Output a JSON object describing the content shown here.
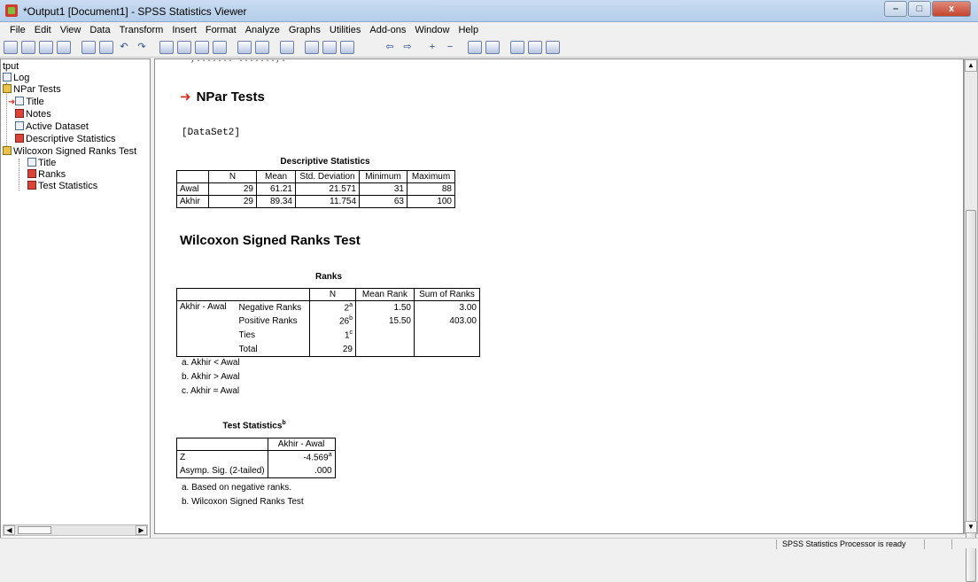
{
  "window": {
    "title": "*Output1 [Document1] - SPSS Statistics Viewer",
    "minimize": "–",
    "maximize": "□",
    "close": "x"
  },
  "menu": [
    "File",
    "Edit",
    "View",
    "Data",
    "Transform",
    "Insert",
    "Format",
    "Analyze",
    "Graphs",
    "Utilities",
    "Add-ons",
    "Window",
    "Help"
  ],
  "toolbar_glyphs": {
    "undo": "↶",
    "redo": "↷",
    "back": "⇦",
    "forward": "⇨",
    "plus": "+",
    "minus": "−"
  },
  "nav": {
    "items": [
      "tput",
      "Log",
      "NPar Tests",
      "Title",
      "Notes",
      "Active Dataset",
      "Descriptive Statistics",
      "Wilcoxon Signed Ranks Test",
      "Title",
      "Ranks",
      "Test Statistics"
    ]
  },
  "content": {
    "cut_text": ",....... .......,.",
    "heading1": "NPar Tests",
    "dataset": "[DataSet2]",
    "desc": {
      "title": "Descriptive Statistics",
      "headers": [
        "",
        "N",
        "Mean",
        "Std. Deviation",
        "Minimum",
        "Maximum"
      ],
      "rows": [
        [
          "Awal",
          "29",
          "61.21",
          "21.571",
          "31",
          "88"
        ],
        [
          "Akhir",
          "29",
          "89.34",
          "11.754",
          "63",
          "100"
        ]
      ]
    },
    "heading2": "Wilcoxon Signed Ranks Test",
    "ranks": {
      "title": "Ranks",
      "headers": [
        "",
        "",
        "N",
        "Mean Rank",
        "Sum of Ranks"
      ],
      "group": "Akhir - Awal",
      "rows": [
        {
          "label": "Negative Ranks",
          "n": "2",
          "sup": "a",
          "mean": "1.50",
          "sum": "3.00"
        },
        {
          "label": "Positive Ranks",
          "n": "26",
          "sup": "b",
          "mean": "15.50",
          "sum": "403.00"
        },
        {
          "label": "Ties",
          "n": "1",
          "sup": "c",
          "mean": "",
          "sum": ""
        },
        {
          "label": "Total",
          "n": "29",
          "sup": "",
          "mean": "",
          "sum": ""
        }
      ],
      "footnotes": [
        "a. Akhir < Awal",
        "b. Akhir > Awal",
        "c. Akhir = Awal"
      ]
    },
    "teststats": {
      "title": "Test Statistics",
      "title_sup": "b",
      "header": "Akhir - Awal",
      "rows": [
        {
          "label": "Z",
          "value": "-4.569",
          "sup": "a"
        },
        {
          "label": "Asymp. Sig. (2-tailed)",
          "value": ".000",
          "sup": ""
        }
      ],
      "footnotes": [
        "a. Based on negative ranks.",
        "b. Wilcoxon Signed Ranks Test"
      ]
    }
  },
  "status": "SPSS Statistics  Processor is ready"
}
